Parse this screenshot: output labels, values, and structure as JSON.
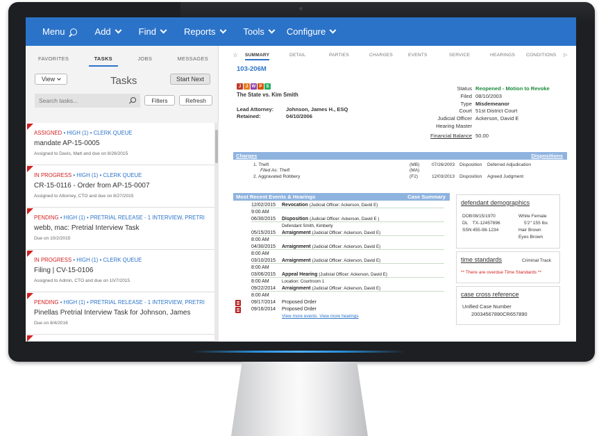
{
  "nav": {
    "items": [
      "Menu",
      "Add",
      "Find",
      "Reports",
      "Tools",
      "Configure"
    ]
  },
  "left": {
    "tabs": [
      "FAVORITES",
      "TASKS",
      "JOBS",
      "MESSAGES"
    ],
    "view_label": "View",
    "title": "Tasks",
    "start_next": "Start Next",
    "search_placeholder": "Search tasks...",
    "filters": "Filters",
    "refresh": "Refresh",
    "tasks": [
      {
        "status": "ASSIGNED",
        "meta": " • HIGH (1) • CLERK QUEUE",
        "title": "mandate AP-15-0005",
        "sub": "Assigned to Davis, Matt and due on 8/26/2015"
      },
      {
        "status": "IN PROGRESS",
        "meta": " • HIGH (1) • CLERK QUEUE",
        "title": "CR-15-0116 - Order from AP-15-0007",
        "sub": "Assigned to Attorney, CTO and due on 8/27/2015"
      },
      {
        "status": "PENDING",
        "meta": " • HIGH (1) • PRETRIAL RELEASE - 1 INTERVIEW, PRETRI",
        "title": "webb, mac: Pretrial Interview Task",
        "sub": "Due on 10/2/2015"
      },
      {
        "status": "IN PROGRESS",
        "meta": " • HIGH (1) • CLERK QUEUE",
        "title": "Filing | CV-15-0106",
        "sub": "Assigned to Admin, CTO and due on 10/7/2015"
      },
      {
        "status": "PENDING",
        "meta": " • HIGH (1) • PRETRIAL RELEASE - 1 INTERVIEW, PRETRI",
        "title": "Pinellas Pretrial Interview Task for Johnson, James",
        "sub": "Due on 8/4/2016"
      }
    ]
  },
  "right": {
    "tabs": [
      "SUMMARY",
      "DETAIL",
      "PARTIES",
      "CHARGES",
      "EVENTS",
      "SERVICE",
      "HEARINGS",
      "CONDITIONS"
    ],
    "case_number": "103-206M",
    "case_name": "The State vs. Kim Smith",
    "lead_attorney_label": "Lead Attorney:",
    "retained_label": "Retained:",
    "lead_attorney": "Johnson, James H., ESQ",
    "retained": "04/10/2006",
    "status": [
      {
        "k": "Status",
        "v": "Reopened - Motion to Revoke"
      },
      {
        "k": "Filed",
        "v": "08/10/2003"
      },
      {
        "k": "Type",
        "v": "Misdemeanor"
      },
      {
        "k": "Court",
        "v": "51st District Court"
      },
      {
        "k": "Judicial Officer",
        "v": "Ackerson, David E"
      },
      {
        "k": "Hearing Master",
        "v": ""
      },
      {
        "k": "Financial Balance",
        "v": "50.00"
      }
    ],
    "charges_title": "Charges",
    "dispositions_link": "Dispositions",
    "charges": [
      {
        "name": "1. Theft",
        "sub": "Filed As: Theft",
        "code": "(MB)",
        "code2": "(MA)",
        "date": "07/26/2003",
        "disp_label": "Disposition",
        "disp": "Deferred Adjudication"
      },
      {
        "name": "2. Aggravated Robbery",
        "code": "(F2)",
        "date": "12/03/2013",
        "disp_label": "Disposition",
        "disp": "Agreed Judgment"
      }
    ],
    "events_title": "Most Recent Events & Hearings",
    "case_summary_link": "Case Summary",
    "events": [
      {
        "date": "12/02/2015",
        "name": "Revocation",
        "extra": "(Judicial Officer: Ackerson, David E)",
        "time": "9:00 AM"
      },
      {
        "date": "06/30/2015",
        "name": "Disposition",
        "extra": "(Judicial Officer: Ackerson, David E )",
        "sub": "Defendant Smith, Kimberly"
      },
      {
        "date": "05/15/2015",
        "name": "Arraignment",
        "extra": "(Judicial Officer: Ackerson, David E)",
        "time": "8:00 AM"
      },
      {
        "date": "04/30/2015",
        "name": "Arraignment",
        "extra": "(Judicial Officer: Ackerson, David E)",
        "time": "8:00 AM"
      },
      {
        "date": "03/10/2015",
        "name": "Arraignment",
        "extra": "(Judicial Officer: Ackerson, David E)",
        "time": "8:00 AM"
      },
      {
        "date": "03/06/2015",
        "name": "Appeal Hearing",
        "extra": "(Judicial Officer: Ackerson, David E)",
        "time": "8:00 AM",
        "location": "Location: Courtroom 1"
      },
      {
        "date": "09/22/2014",
        "name": "Arraignment",
        "extra": "(Judicial Officer: Ackerson, David E)",
        "time": "8:00 AM"
      },
      {
        "date": "09/17/2014",
        "name": "Proposed Order"
      },
      {
        "date": "09/16/2014",
        "name": "Proposed Order"
      }
    ],
    "view_more_events": "View more events",
    "view_more_hearings": "View more hearings",
    "demo": {
      "title": "defendant demographics",
      "dob_k": "DOB",
      "dob": "08/15/1970",
      "dl_k": "DL",
      "dl": "TX-12457896",
      "ssn_k": "SSN",
      "ssn": "455-98-1234",
      "race": "White Female",
      "height": "5'2\" 155 lbs",
      "hair_k": "Hair",
      "hair": "Brown",
      "eyes_k": "Eyes",
      "eyes": "Brown"
    },
    "time": {
      "title": "time standards",
      "track": "Criminal Track",
      "alert": "** There are overdue Time Standards **"
    },
    "xref": {
      "title": "case cross reference",
      "label": "Unified Case Number",
      "value": "20034567890CR657890"
    }
  },
  "colors": {
    "nav_blue": "#2b73c9",
    "status_red": "#d22020",
    "status_green": "#1b8a3a",
    "section_bar": "#8fb3df"
  }
}
